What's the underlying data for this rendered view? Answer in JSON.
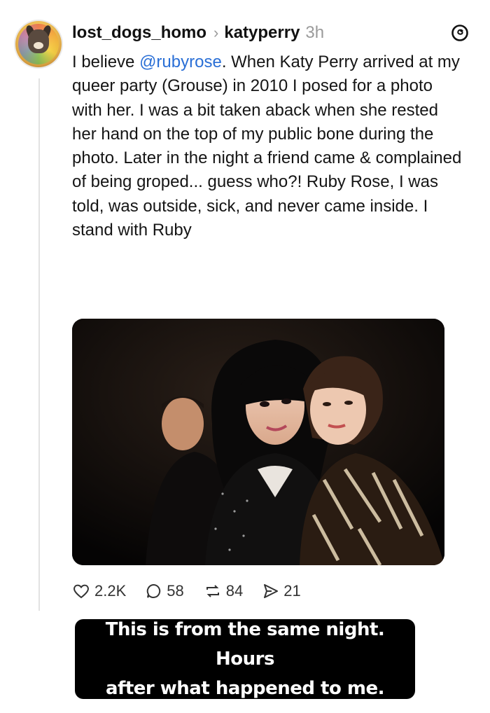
{
  "post": {
    "username": "lost_dogs_homo",
    "reply_to": "katyperry",
    "time": "3h",
    "text_before_mention": "I believe ",
    "mention": "@rubyrose",
    "text_after_mention": ". When Katy Perry arrived at my queer party (Grouse) in 2010 I posed for a photo with her. I was a bit taken aback when she rested her hand on the top of my public bone during the photo. Later in the night a friend came & complained of being groped... guess who?! Ruby Rose, I was told, was outside, sick, and never came inside. I stand with Ruby",
    "icons": {
      "app": "threads-logo-icon",
      "chevron": "chevron-right-icon"
    }
  },
  "stats": {
    "likes": "2.2K",
    "comments": "58",
    "reposts": "84",
    "shares": "21"
  },
  "caption": {
    "line1": "This is from the same night. Hours",
    "line2": "after what happened to me."
  },
  "colors": {
    "mention": "#2a6fd6",
    "muted": "#9a9a9a",
    "caption_bg": "#000000"
  }
}
